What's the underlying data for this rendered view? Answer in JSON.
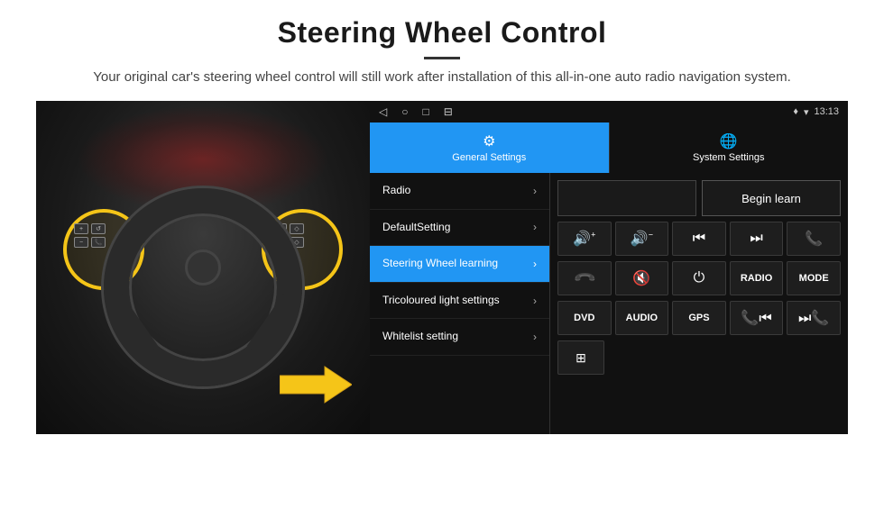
{
  "header": {
    "title": "Steering Wheel Control",
    "subtitle": "Your original car's steering wheel control will still work after installation of this all-in-one auto radio navigation system."
  },
  "status_bar": {
    "time": "13:13",
    "nav_icons": [
      "◁",
      "○",
      "□",
      "⊟"
    ]
  },
  "tabs": [
    {
      "label": "General Settings",
      "icon": "⚙",
      "active": true
    },
    {
      "label": "System Settings",
      "icon": "🌐",
      "active": false
    }
  ],
  "menu": {
    "items": [
      {
        "label": "Radio",
        "active": false
      },
      {
        "label": "DefaultSetting",
        "active": false
      },
      {
        "label": "Steering Wheel learning",
        "active": true
      },
      {
        "label": "Tricoloured light settings",
        "active": false
      },
      {
        "label": "Whitelist setting",
        "active": false
      }
    ]
  },
  "controls": {
    "begin_learn_label": "Begin learn",
    "row1": [
      {
        "icon": "🔊+",
        "label": "Vol+"
      },
      {
        "icon": "🔊-",
        "label": "Vol-"
      },
      {
        "icon": "⏮",
        "label": "Prev"
      },
      {
        "icon": "⏭",
        "label": "Next"
      },
      {
        "icon": "📞",
        "label": "Call"
      }
    ],
    "row2": [
      {
        "icon": "📞",
        "label": "Answer"
      },
      {
        "icon": "🔇",
        "label": "Mute"
      },
      {
        "icon": "⏻",
        "label": "Power"
      },
      {
        "text": "RADIO",
        "label": "Radio"
      },
      {
        "text": "MODE",
        "label": "Mode"
      }
    ],
    "row3": [
      {
        "text": "DVD",
        "label": "DVD"
      },
      {
        "text": "AUDIO",
        "label": "Audio"
      },
      {
        "text": "GPS",
        "label": "GPS"
      },
      {
        "icon": "📞⏮",
        "label": "Tel+Prev"
      },
      {
        "icon": "⏭📞",
        "label": "Next+Tel"
      }
    ],
    "row4": [
      {
        "icon": "≡",
        "label": "Menu"
      }
    ]
  }
}
